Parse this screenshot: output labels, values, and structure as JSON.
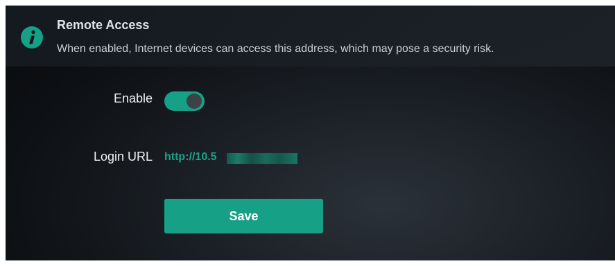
{
  "notice": {
    "icon": "info-icon",
    "title": "Remote Access",
    "description": "When enabled, Internet devices can access this address, which may pose a security risk."
  },
  "form": {
    "enable_label": "Enable",
    "enable_state": true,
    "login_url_label": "Login URL",
    "login_url_value": "http://10.5",
    "save_label": "Save"
  },
  "colors": {
    "accent": "#16a085",
    "link": "#19a38a",
    "background": "#0d1014"
  }
}
